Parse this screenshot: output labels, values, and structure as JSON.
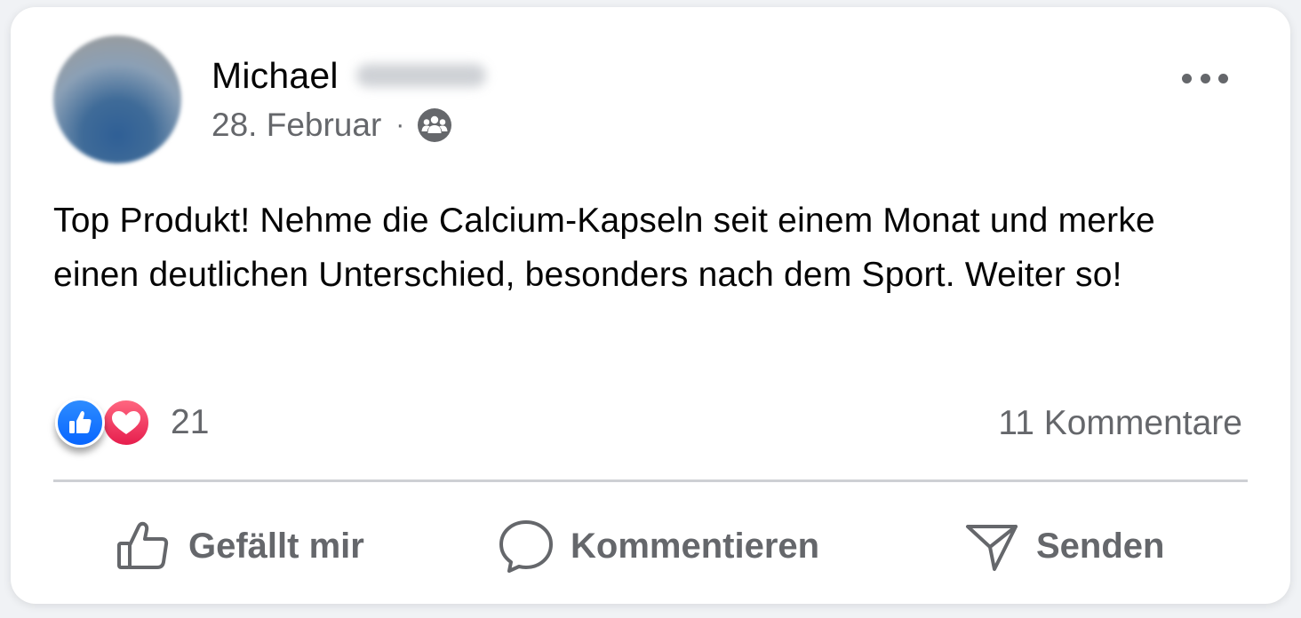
{
  "post": {
    "author_first_name": "Michael",
    "date": "28. Februar",
    "separator": "·",
    "audience_icon": "friends-icon",
    "more_icon": "more-horizontal-icon",
    "text": "Top Produkt! Nehme die Calcium-Kapseln seit einem Monat und merke einen deutlichen Unterschied, besonders nach dem Sport. Weiter so!"
  },
  "reactions": {
    "icons": [
      "like-reaction-icon",
      "love-reaction-icon"
    ],
    "count": "21",
    "colors": {
      "like": "#0866ff",
      "love": "#e61e4d"
    }
  },
  "comments": {
    "count_label": "11 Kommentare"
  },
  "actions": {
    "like_label": "Gefällt mir",
    "comment_label": "Kommentieren",
    "send_label": "Senden"
  },
  "colors": {
    "text_primary": "#050505",
    "text_secondary": "#65676b",
    "divider": "#ced0d4",
    "card_background": "#ffffff"
  }
}
